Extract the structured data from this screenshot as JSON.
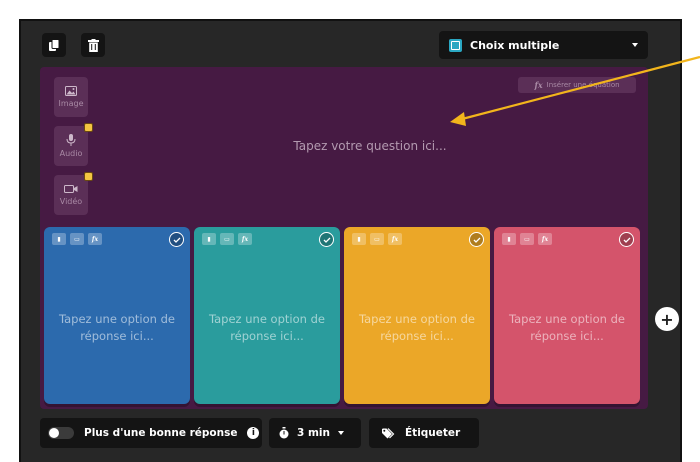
{
  "toolbar": {
    "duplicate_icon": "copy-icon",
    "delete_icon": "trash-icon",
    "question_type": "Choix multiple"
  },
  "editor": {
    "insert_equation": "Insérer une équation",
    "question_placeholder": "Tapez votre question ici...",
    "media": [
      {
        "label": "Image",
        "icon": "image-icon"
      },
      {
        "label": "Audio",
        "icon": "microphone-icon"
      },
      {
        "label": "Vidéo",
        "icon": "video-camera-icon"
      }
    ]
  },
  "options": [
    {
      "placeholder": "Tapez une option de réponse ici...",
      "color": "#2c6aad"
    },
    {
      "placeholder": "Tapez une option de réponse ici...",
      "color": "#2a9c9d"
    },
    {
      "placeholder": "Tapez une option de réponse ici...",
      "color": "#eba728"
    },
    {
      "placeholder": "Tapez une option de réponse ici...",
      "color": "#d4546b"
    }
  ],
  "option_tool_labels": {
    "equation": "fx"
  },
  "bottom": {
    "multiple_correct": "Plus d'une bonne réponse",
    "time": "3 min",
    "tag": "Étiqueter"
  },
  "colors": {
    "editor_bg": "#461a43",
    "arrow": "#f2b51c"
  }
}
